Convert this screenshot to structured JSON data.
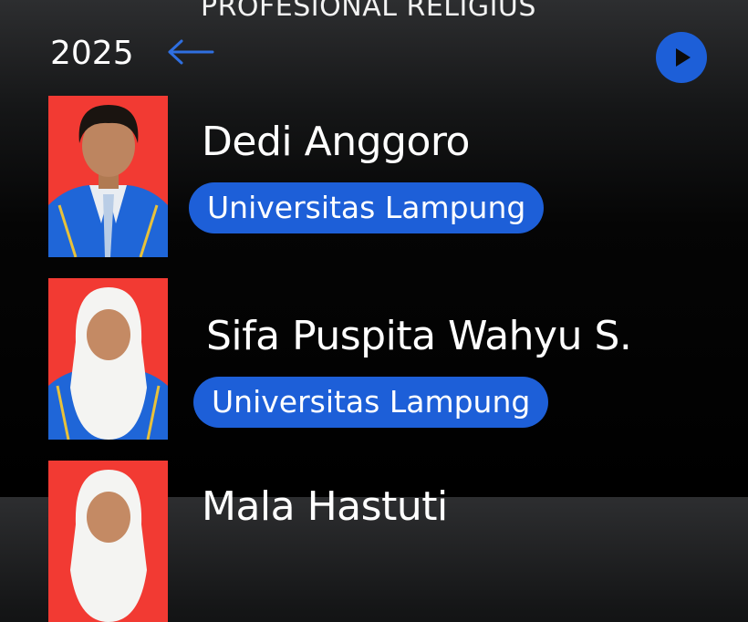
{
  "header": {
    "title": "PROFESIONAL RELIGIUS",
    "year": "2025",
    "back_icon": "arrow-left-icon",
    "play_icon": "play-icon"
  },
  "colors": {
    "accent": "#1d5fd8",
    "photo_background": "#f23a33",
    "background": "#000000"
  },
  "students": [
    {
      "name": "Dedi Anggoro",
      "university": "Universitas Lampung"
    },
    {
      "name": "Sifa Puspita Wahyu S.",
      "university": "Universitas Lampung"
    },
    {
      "name": "Mala Hastuti",
      "university": ""
    }
  ]
}
